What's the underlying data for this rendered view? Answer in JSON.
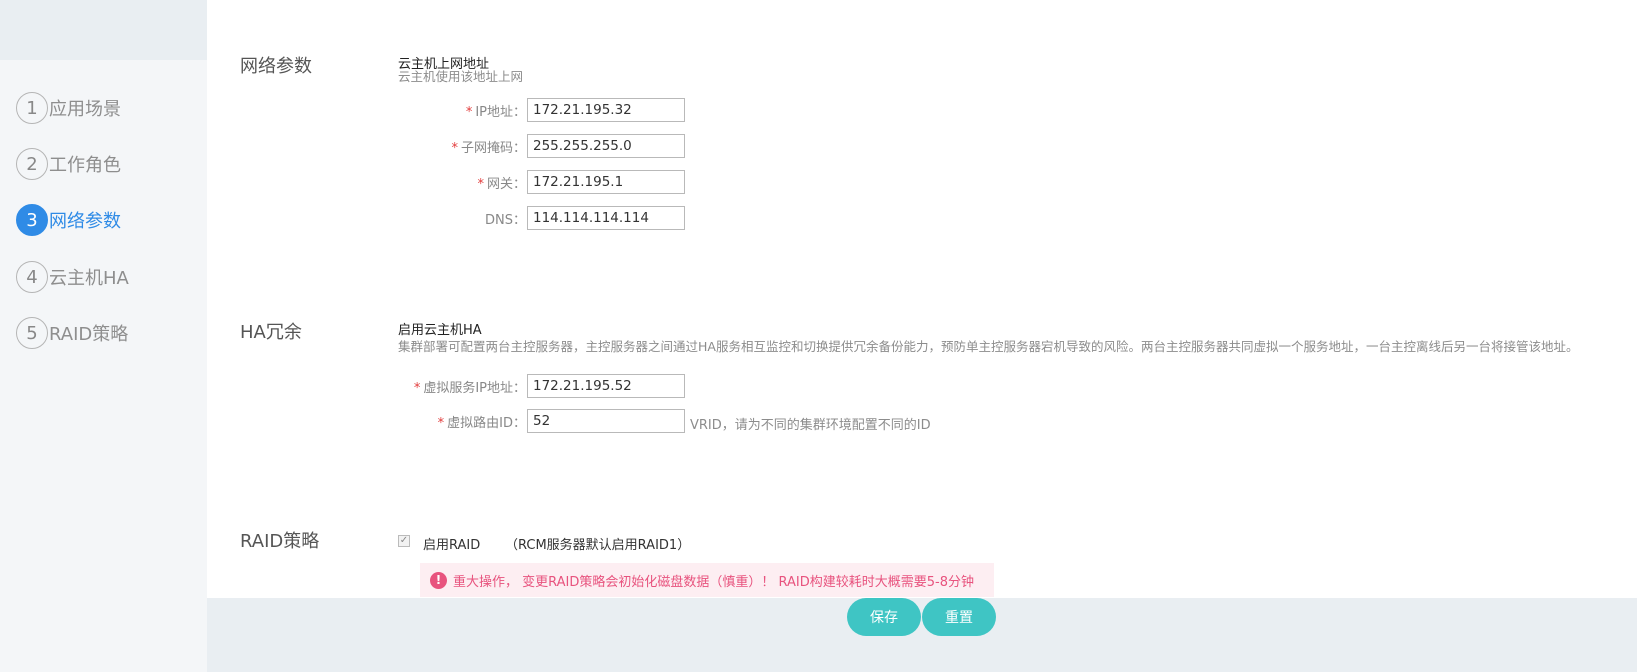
{
  "sidebar": {
    "steps": [
      {
        "num": "1",
        "label": "应用场景"
      },
      {
        "num": "2",
        "label": "工作角色"
      },
      {
        "num": "3",
        "label": "网络参数"
      },
      {
        "num": "4",
        "label": "云主机HA"
      },
      {
        "num": "5",
        "label": "RAID策略"
      }
    ],
    "active_step": "3"
  },
  "network": {
    "title": "网络参数",
    "subtitle": "云主机上网地址",
    "desc": "云主机使用该地址上网",
    "ip_label": "IP地址：",
    "ip_value": "172.21.195.32",
    "mask_label": "子网掩码：",
    "mask_value": "255.255.255.0",
    "gateway_label": "网关：",
    "gateway_value": "172.21.195.1",
    "dns_label": "DNS：",
    "dns_value": "114.114.114.114"
  },
  "ha": {
    "title": "HA冗余",
    "subtitle": "启用云主机HA",
    "desc": "集群部署可配置两台主控服务器，主控服务器之间通过HA服务相互监控和切换提供冗余备份能力，预防单主控服务器宕机导致的风险。两台主控服务器共同虚拟一个服务地址，一台主控离线后另一台将接管该地址。",
    "vip_label": "虚拟服务IP地址：",
    "vip_value": "172.21.195.52",
    "vrid_label": "虚拟路由ID：",
    "vrid_value": "52",
    "vrid_hint": "VRID，请为不同的集群环境配置不同的ID"
  },
  "raid": {
    "title": "RAID策略",
    "checkbox_label": "启用RAID",
    "checked": true,
    "note": "（RCM服务器默认启用RAID1）",
    "warning": "重大操作， 变更RAID策略会初始化磁盘数据（慎重）！ RAID构建较耗时大概需要5-8分钟"
  },
  "actions": {
    "save_label": "保存",
    "reset_label": "重置"
  },
  "colors": {
    "accent": "#2f8be6",
    "button": "#3fc5c4",
    "warning_text": "#e8537e",
    "warning_bg": "#fdeef2",
    "required": "#e23b3b"
  },
  "icons": {
    "warning": "exclamation-circle-icon",
    "checkbox": "checkmark-icon"
  }
}
